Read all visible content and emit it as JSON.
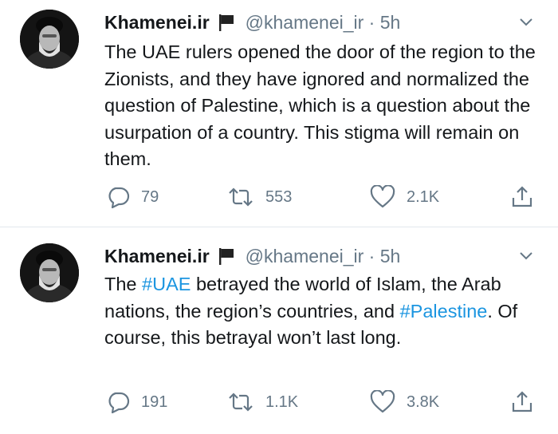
{
  "tweets": [
    {
      "author": {
        "name": "Khamenei.ir",
        "handle": "@khamenei_ir",
        "time": "5h"
      },
      "text_parts": [
        {
          "text": "The UAE rulers opened the door of the region to the Zionists, and they have ignored and normalized the question of Palestine, which is a question about the usurpation of a country. This stigma will remain on them.",
          "hashtag": false
        }
      ],
      "stats": {
        "replies": "79",
        "retweets": "553",
        "likes": "2.1K"
      }
    },
    {
      "author": {
        "name": "Khamenei.ir",
        "handle": "@khamenei_ir",
        "time": "5h"
      },
      "text_parts": [
        {
          "text": "The ",
          "hashtag": false
        },
        {
          "text": "#UAE",
          "hashtag": true
        },
        {
          "text": " betrayed the world of Islam, the Arab nations, the region’s countries, and ",
          "hashtag": false
        },
        {
          "text": "#Palestine",
          "hashtag": true
        },
        {
          "text": ". Of course, this betrayal won’t last long.",
          "hashtag": false
        }
      ],
      "stats": {
        "replies": "191",
        "retweets": "1.1K",
        "likes": "3.8K"
      }
    }
  ],
  "colors": {
    "text": "#14171a",
    "muted": "#657786",
    "link": "#1b95e0",
    "divider": "#e1e8ed"
  },
  "icons": [
    "avatar-photo",
    "flag-icon",
    "chevron-down-icon",
    "reply-icon",
    "retweet-icon",
    "like-icon",
    "share-icon"
  ]
}
